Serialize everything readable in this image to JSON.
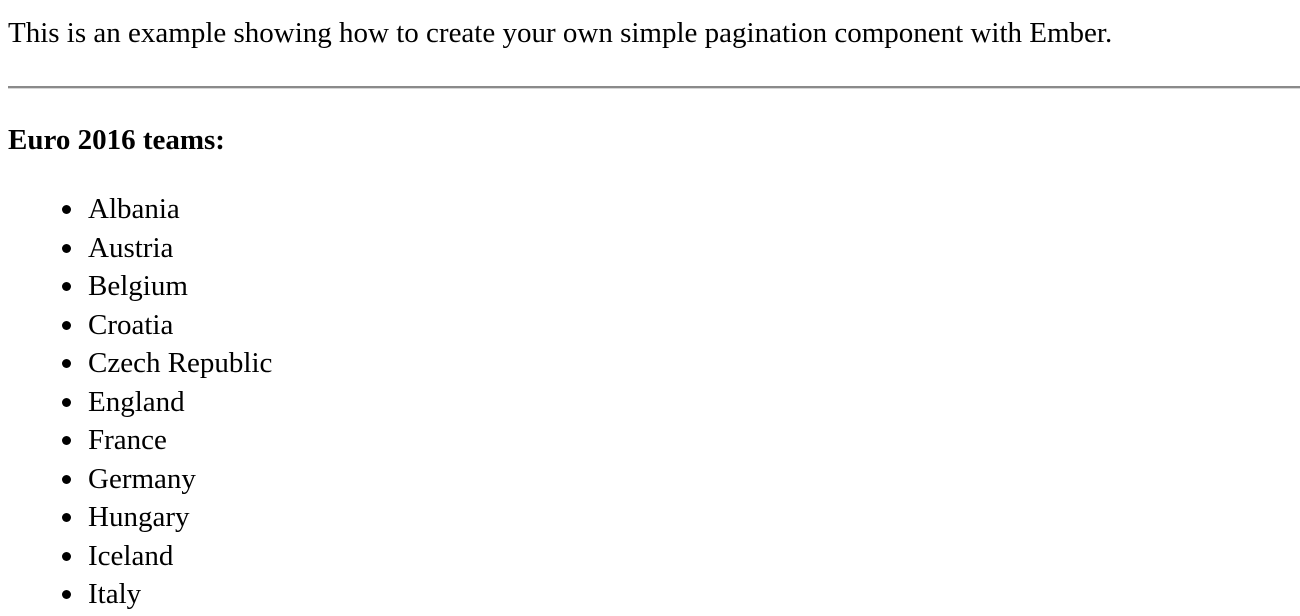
{
  "intro_text": "This is an example showing how to create your own simple pagination component with Ember.",
  "teams_heading": "Euro 2016 teams:",
  "teams": [
    "Albania",
    "Austria",
    "Belgium",
    "Croatia",
    "Czech Republic",
    "England",
    "France",
    "Germany",
    "Hungary",
    "Iceland",
    "Italy"
  ]
}
